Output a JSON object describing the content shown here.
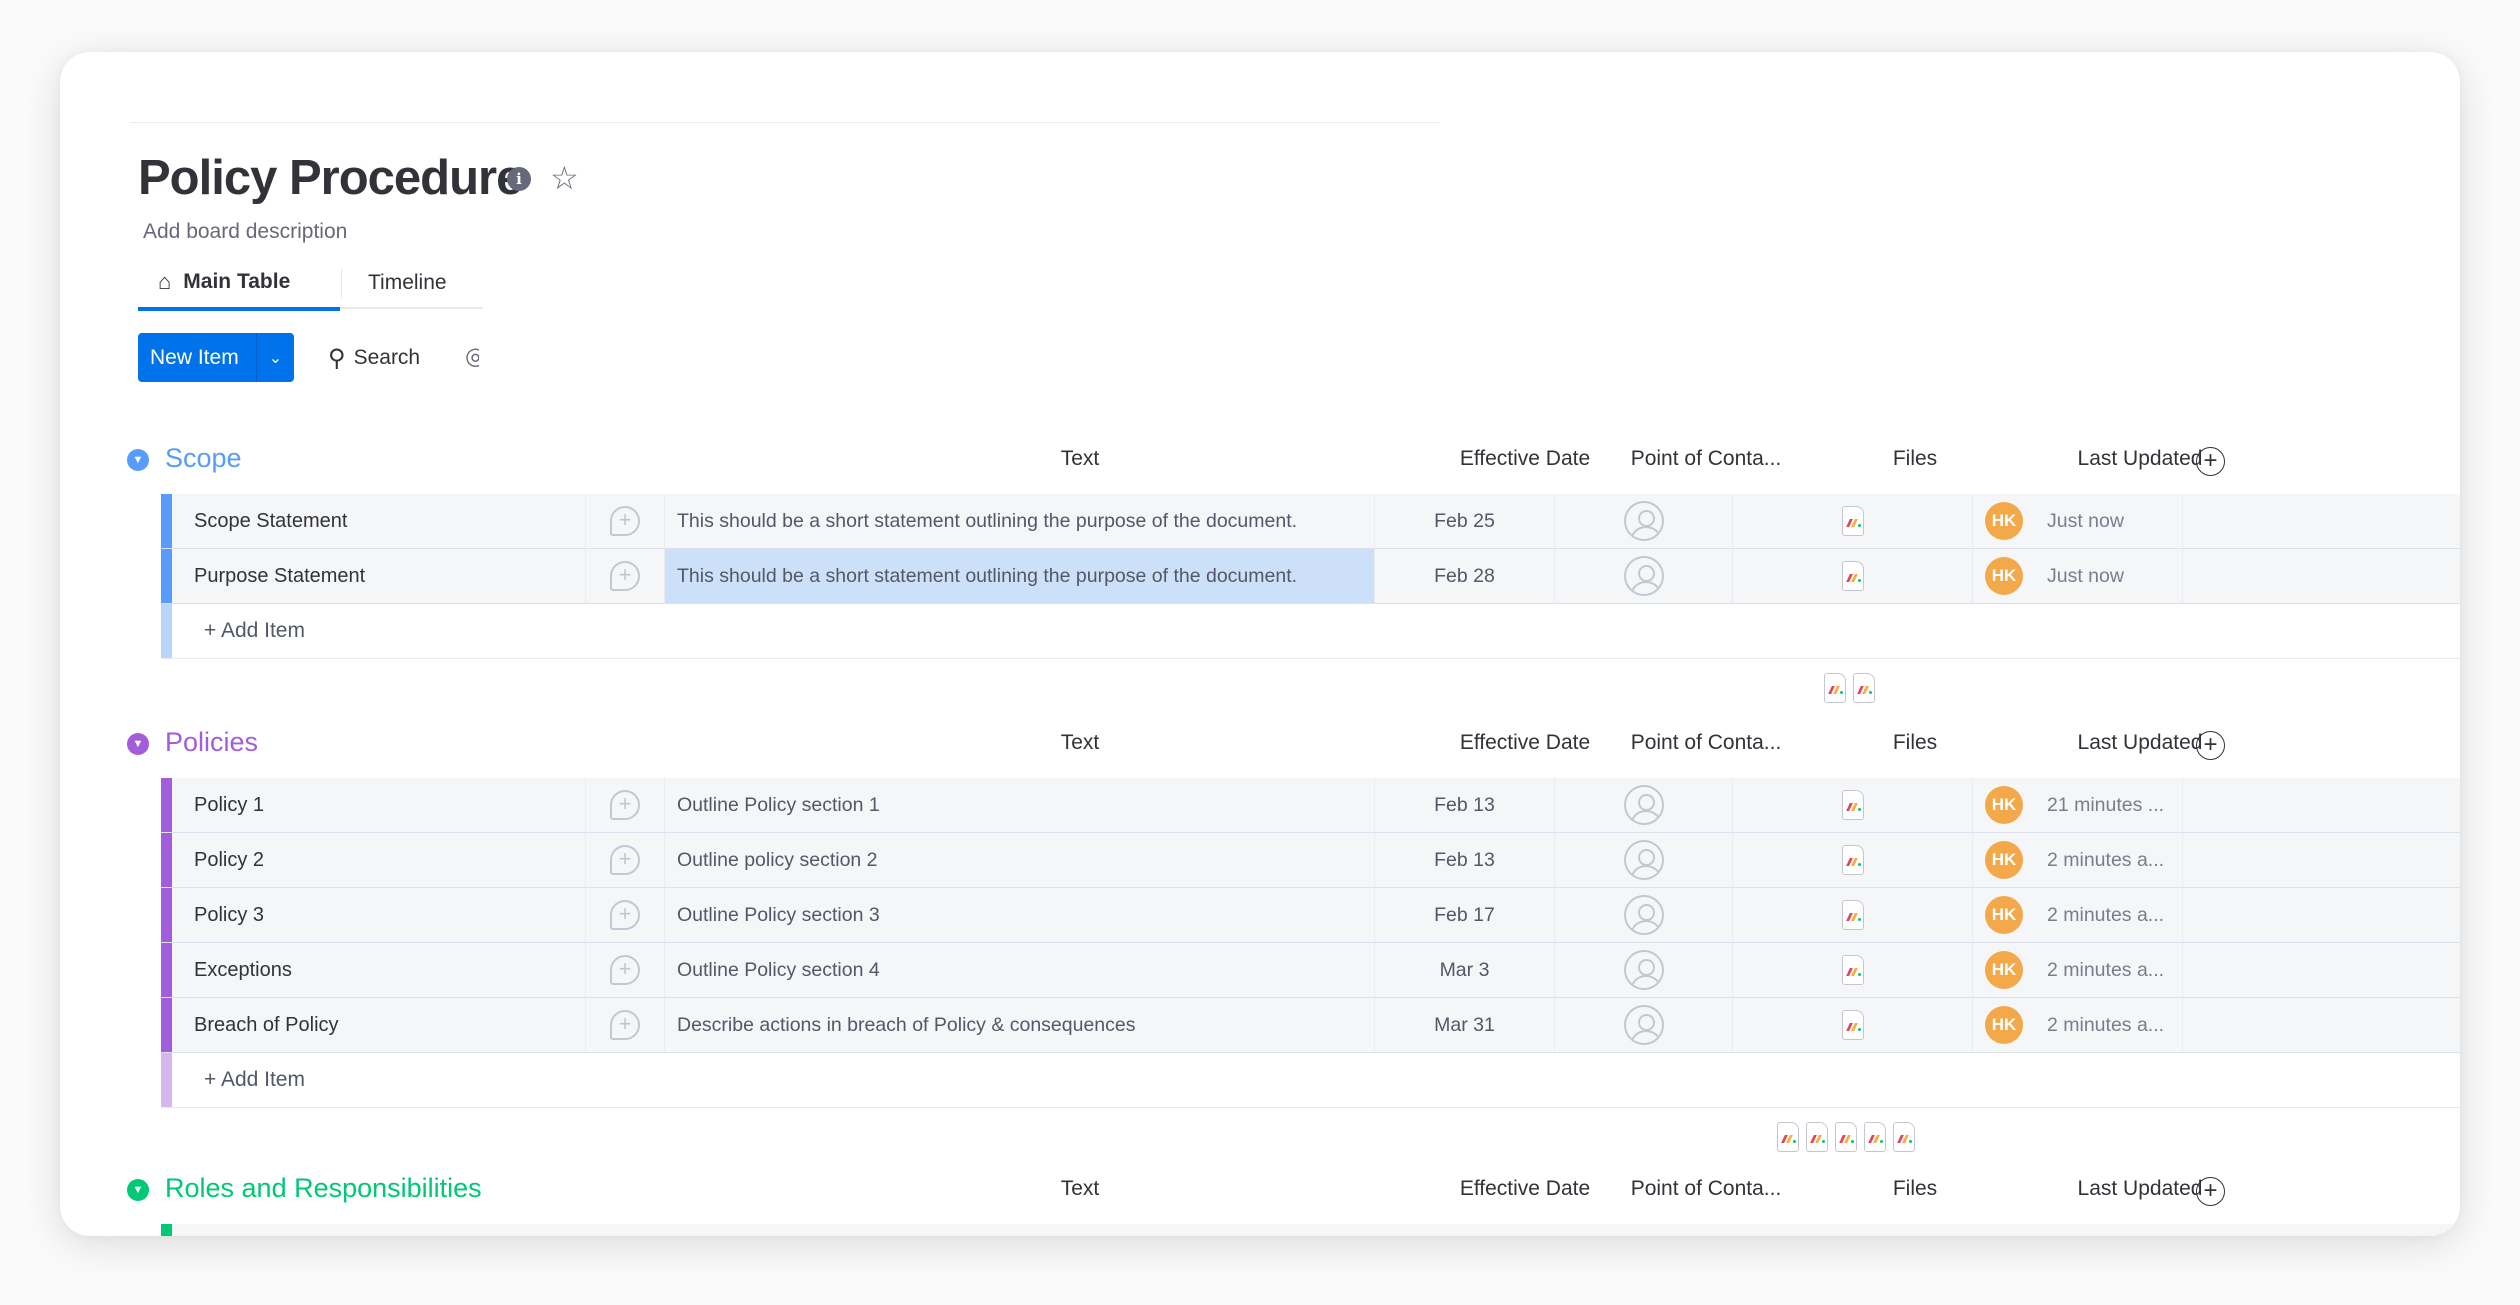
{
  "board": {
    "title": "Policy Procedure",
    "description_placeholder": "Add board description",
    "info_icon": "info-icon",
    "favorite_icon": "star-icon"
  },
  "tabs": [
    {
      "label": "Main Table",
      "icon": "home-icon",
      "active": true
    },
    {
      "label": "Timeline",
      "active": false
    }
  ],
  "toolbar": {
    "new_item_label": "New Item",
    "new_item_dropdown_icon": "chevron-down-icon",
    "search_label": "Search",
    "search_icon": "search-icon"
  },
  "columns": [
    "Text",
    "Effective Date",
    "Point of Conta...",
    "Files",
    "Last Updated"
  ],
  "add_item_label": "+ Add Item",
  "colors": {
    "accent": "#0073ea",
    "scope": "#579bfc",
    "policies": "#a25ddc",
    "roles": "#00c875",
    "avatar": "#f3a84a",
    "selected_cell": "#cce1f9"
  },
  "groups": [
    {
      "title": "Scope",
      "color": "#579bfc",
      "light_color": "#b9d4fd",
      "summary_file_count": 2,
      "items": [
        {
          "name": "Scope Statement",
          "text": "This should be a short statement outlining the purpose of the document.",
          "date": "Feb 25",
          "updated_by": "HK",
          "updated": "Just now",
          "selected": false
        },
        {
          "name": "Purpose Statement",
          "text": "This should be a short statement outlining the purpose of the document.",
          "date": "Feb 28",
          "updated_by": "HK",
          "updated": "Just now",
          "selected": true
        }
      ]
    },
    {
      "title": "Policies",
      "color": "#a25ddc",
      "light_color": "#d5b6ef",
      "summary_file_count": 5,
      "items": [
        {
          "name": "Policy 1",
          "text": "Outline Policy section 1",
          "date": "Feb 13",
          "updated_by": "HK",
          "updated": "21 minutes ...",
          "selected": false
        },
        {
          "name": "Policy 2",
          "text": "Outline policy section 2",
          "date": "Feb 13",
          "updated_by": "HK",
          "updated": "2 minutes a...",
          "selected": false
        },
        {
          "name": "Policy 3",
          "text": "Outline Policy section 3",
          "date": "Feb 17",
          "updated_by": "HK",
          "updated": "2 minutes a...",
          "selected": false
        },
        {
          "name": "Exceptions",
          "text": "Outline Policy section 4",
          "date": "Mar 3",
          "updated_by": "HK",
          "updated": "2 minutes a...",
          "selected": false
        },
        {
          "name": "Breach of Policy",
          "text": "Describe actions in breach of Policy & consequences",
          "date": "Mar 31",
          "updated_by": "HK",
          "updated": "2 minutes a...",
          "selected": false
        }
      ]
    },
    {
      "title": "Roles and Responsibilities",
      "color": "#00c875",
      "light_color": "#9be8c6",
      "items": []
    }
  ]
}
